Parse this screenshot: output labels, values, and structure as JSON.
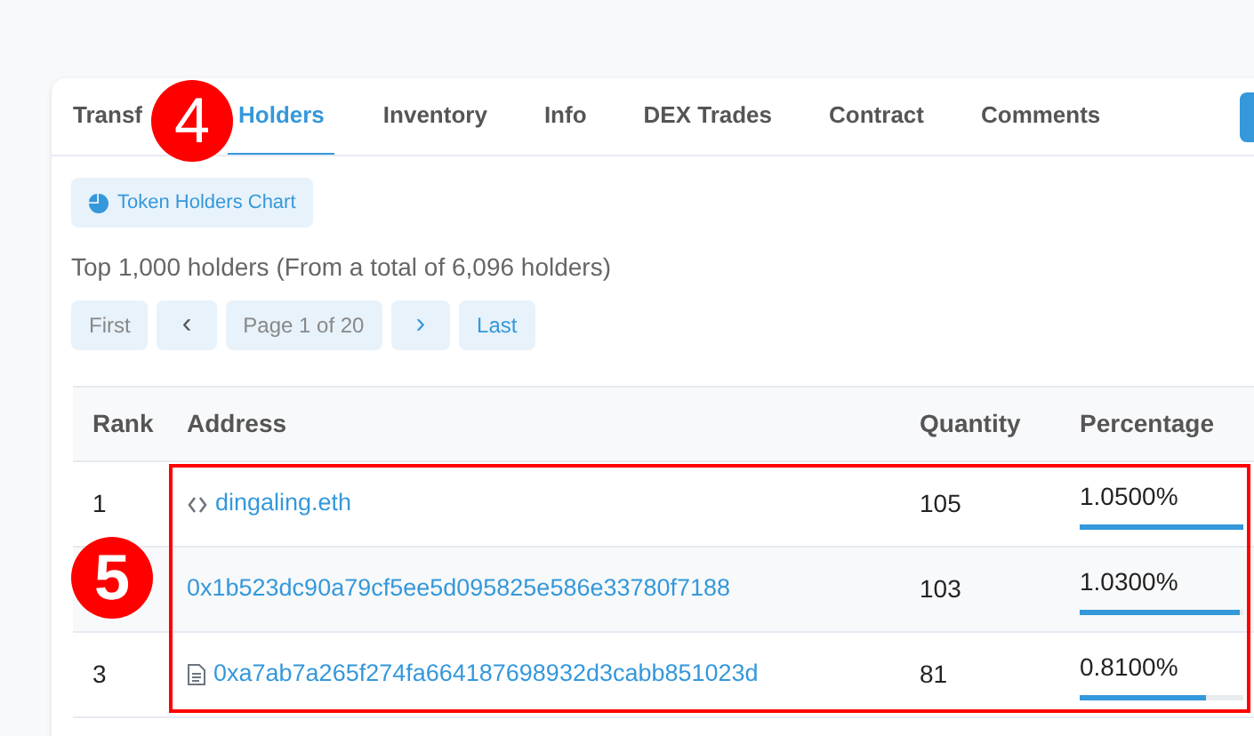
{
  "tabs": [
    {
      "label": "Transf",
      "selected": false
    },
    {
      "label": "Holders",
      "selected": true
    },
    {
      "label": "Inventory",
      "selected": false
    },
    {
      "label": "Info",
      "selected": false
    },
    {
      "label": "DEX Trades",
      "selected": false
    },
    {
      "label": "Contract",
      "selected": false
    },
    {
      "label": "Comments",
      "selected": false
    }
  ],
  "chart_button": "Token Holders Chart",
  "summary": "Top 1,000 holders (From a total of 6,096 holders)",
  "pagination": {
    "first": "First",
    "prev": "‹",
    "page": "Page 1 of 20",
    "next": "›",
    "last": "Last"
  },
  "table": {
    "columns": [
      "Rank",
      "Address",
      "Quantity",
      "Percentage"
    ],
    "rows": [
      {
        "rank": "1",
        "kind": "contract",
        "address": "dingaling.eth",
        "quantity": "105",
        "percentage": "1.0500%",
        "level": 1.0
      },
      {
        "kind": "plain",
        "address": "0x1b523dc90a79cf5ee5d095825e586e33780f7188",
        "quantity": "103",
        "percentage": "1.0300%",
        "level": 0.98
      },
      {
        "rank": "3",
        "kind": "document",
        "address": "0xa7ab7a265f274fa664187698932d3cabb851023d",
        "quantity": "81",
        "percentage": "0.8100%",
        "level": 0.77
      }
    ]
  },
  "annotations": [
    {
      "label": "4"
    },
    {
      "label": "5"
    }
  ]
}
